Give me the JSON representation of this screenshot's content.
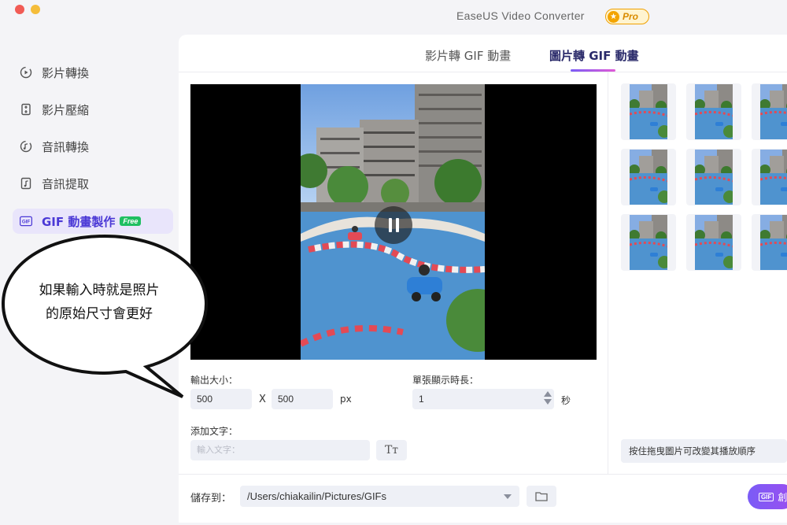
{
  "app": {
    "title": "EaseUS Video Converter",
    "pro_label": "Pro",
    "pro_star": "★"
  },
  "sidebar": {
    "items": [
      {
        "label": "影片轉換",
        "icon": "video-convert-icon"
      },
      {
        "label": "影片壓縮",
        "icon": "compress-icon"
      },
      {
        "label": "音訊轉換",
        "icon": "audio-convert-icon"
      },
      {
        "label": "音訊提取",
        "icon": "audio-extract-icon"
      },
      {
        "label": "GIF 動畫製作",
        "icon": "gif-icon",
        "badge": "Free",
        "active": true
      }
    ]
  },
  "tabs": [
    {
      "label": "影片轉 GIF 動畫",
      "active": false
    },
    {
      "label": "圖片轉 GIF 動畫",
      "active": true
    }
  ],
  "output": {
    "size_label": "輸出大小：",
    "width": "500",
    "separator": "X",
    "height": "500",
    "unit": "px"
  },
  "duration": {
    "label": "單張顯示時長：",
    "value": "1",
    "unit": "秒"
  },
  "text": {
    "label": "添加文字：",
    "placeholder": "輸入文字：",
    "font_button": "Tт"
  },
  "thumbnails": {
    "hint": "按住拖曳圖片可改變其播放順序",
    "count": 9
  },
  "save": {
    "label": "儲存到：",
    "path": "/Users/chiakailin/Pictures/GIFs"
  },
  "create_button": {
    "icon_text": "GIF",
    "label": "創"
  },
  "annotation": {
    "line1": "如果輸入時就是照片",
    "line2": "的原始尺寸會更好"
  },
  "colors": {
    "accent": "#7b5cf6",
    "active_bg": "#e9e5fb",
    "free_badge": "#1fbf61",
    "pro_border": "#f0a000"
  }
}
